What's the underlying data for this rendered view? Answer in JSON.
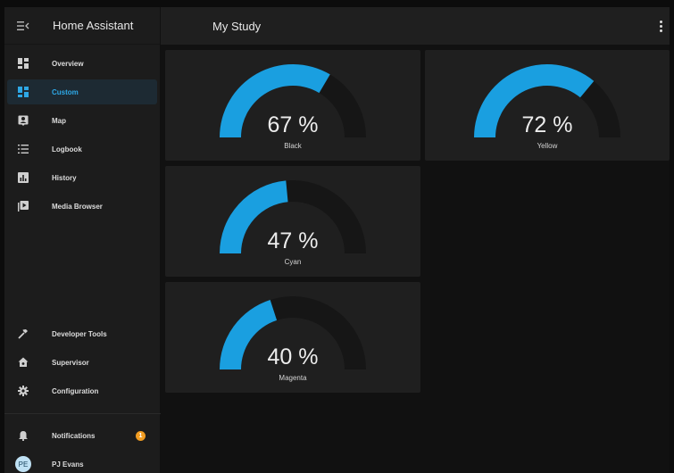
{
  "sidebar": {
    "title": "Home Assistant",
    "menu_icon": "menu-collapse-icon",
    "items": [
      {
        "label": "Overview",
        "icon": "dashboard-icon",
        "active": false
      },
      {
        "label": "Custom",
        "icon": "dashboard-icon",
        "active": true
      },
      {
        "label": "Map",
        "icon": "map-person-icon",
        "active": false
      },
      {
        "label": "Logbook",
        "icon": "list-icon",
        "active": false
      },
      {
        "label": "History",
        "icon": "chart-box-icon",
        "active": false
      },
      {
        "label": "Media Browser",
        "icon": "media-play-icon",
        "active": false
      }
    ],
    "bottom_items": [
      {
        "label": "Developer Tools",
        "icon": "hammer-icon"
      },
      {
        "label": "Supervisor",
        "icon": "home-assistant-icon"
      },
      {
        "label": "Configuration",
        "icon": "gear-icon"
      }
    ],
    "notifications": {
      "label": "Notifications",
      "icon": "bell-icon",
      "count": "1"
    },
    "user": {
      "initials": "PE",
      "name": "PJ Evans"
    }
  },
  "header": {
    "title": "My Study",
    "menu_icon": "more-vertical-icon"
  },
  "gauges": [
    {
      "value_text": "67 %",
      "value": 67,
      "name": "Black"
    },
    {
      "value_text": "72 %",
      "value": 72,
      "name": "Yellow"
    },
    {
      "value_text": "47 %",
      "value": 47,
      "name": "Cyan"
    },
    {
      "value_text": "40 %",
      "value": 40,
      "name": "Magenta"
    }
  ],
  "colors": {
    "accent": "#2ea8e6",
    "gauge_fill": "#1a9fe0",
    "gauge_track": "#161616",
    "card": "#1f1f1f",
    "sidebar": "#1c1c1c",
    "badge": "#f19c21"
  }
}
